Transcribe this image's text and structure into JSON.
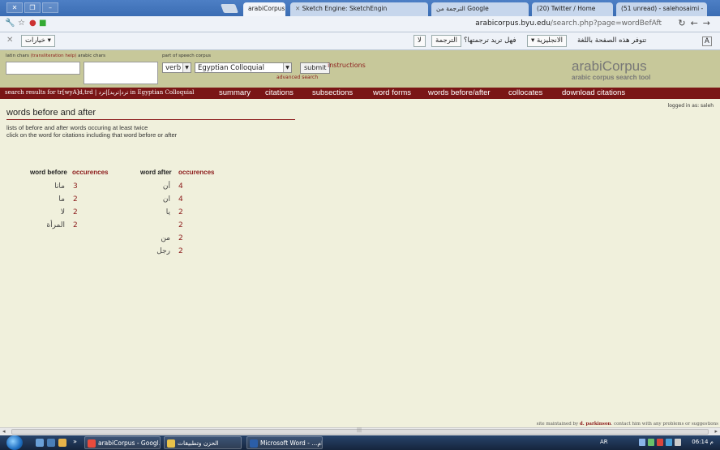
{
  "browser": {
    "tabs": [
      {
        "label": "arabiCorpus",
        "active": true
      },
      {
        "label": "Sketch Engine: SketchEngin",
        "active": false
      },
      {
        "label": "الترجمة من Google",
        "active": false
      },
      {
        "label": "(20) Twitter / Home",
        "active": false
      },
      {
        "label": "(51 unread) - salehosaimi -",
        "active": false
      }
    ],
    "url_domain": "arabicorpus.byu.edu",
    "url_path": "/search.php?page=wordBefAft",
    "options_label": "خيارات"
  },
  "translate_bar": {
    "message": "تتوفر هذه الصفحة باللغة",
    "language": "الانجليزية",
    "question": "فهل تريد ترجمتها؟",
    "translate_button": "الترجمة",
    "no_button": "لا"
  },
  "search_form": {
    "latin_label": "latin chars",
    "translit_help": "(transliteration help)",
    "arabic_label": "arabic chars",
    "pos_label": "part of speech",
    "corpus_label": "corpus",
    "pos_value": "verb",
    "corpus_value": "Egyptian Colloquial",
    "submit_label": "submit",
    "instructions_label": "instructions",
    "advanced_label": "advanced search"
  },
  "brand": {
    "name": "arabiCorpus",
    "tagline": "arabic corpus search tool"
  },
  "nav": {
    "results_text": "search results for tr[wyA]d,trd | ترد|تريد]|ترد in Egyptian Colloquial",
    "items": [
      "summary",
      "citations",
      "subsections",
      "word forms",
      "words before/after",
      "collocates",
      "download citations"
    ]
  },
  "logged_in": "logged in as: saleh",
  "page": {
    "title": "words before and after",
    "desc_line1": "lists of before and after words occuring at least twice",
    "desc_line2": "click on the word for citations including that word before or after"
  },
  "table": {
    "before_header": "word before",
    "after_header": "word after",
    "occ_header": "occurences",
    "before_rows": [
      {
        "word": "مانا",
        "count": "3"
      },
      {
        "word": "ما",
        "count": "2"
      },
      {
        "word": "لا",
        "count": "2"
      },
      {
        "word": "المرأة",
        "count": "2"
      }
    ],
    "after_rows": [
      {
        "word": "أن",
        "count": "4"
      },
      {
        "word": "ان",
        "count": "4"
      },
      {
        "word": "يا",
        "count": "2"
      },
      {
        "word": "",
        "count": "2"
      },
      {
        "word": "من",
        "count": "2"
      },
      {
        "word": "رجل",
        "count": "2"
      }
    ]
  },
  "footer": {
    "prefix": "site maintained by",
    "maintainer": "d. parkinson",
    "suffix": "contact him with any problems or suggestions"
  },
  "taskbar": {
    "items": [
      "arabiCorpus - Googl...",
      "الحزن وتطبيقات",
      "Microsoft Word - ...ام"
    ],
    "lang": "AR",
    "clock": "06:14 م"
  },
  "colors": {
    "accent": "#7a1616",
    "header_bg": "#c7c89a",
    "page_bg": "#f0f0dc"
  }
}
